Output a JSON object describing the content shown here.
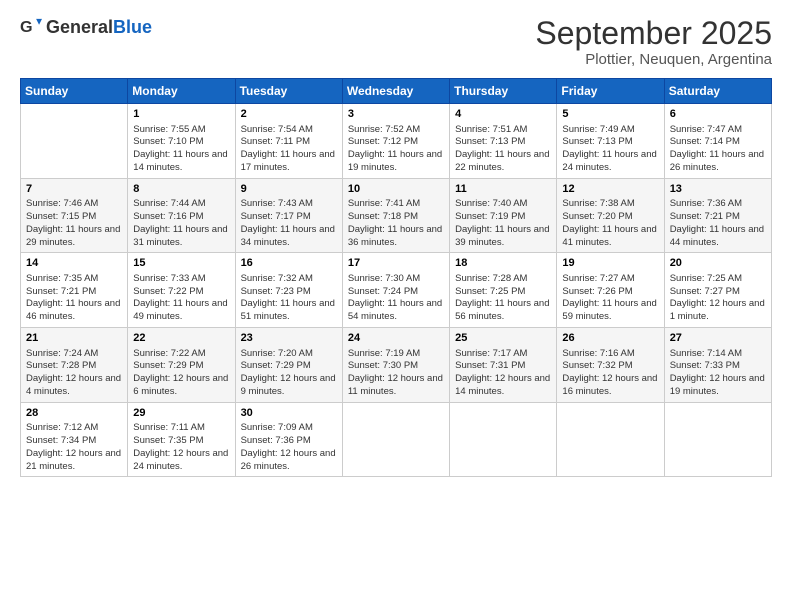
{
  "logo": {
    "general": "General",
    "blue": "Blue"
  },
  "title": "September 2025",
  "subtitle": "Plottier, Neuquen, Argentina",
  "days": [
    "Sunday",
    "Monday",
    "Tuesday",
    "Wednesday",
    "Thursday",
    "Friday",
    "Saturday"
  ],
  "weeks": [
    [
      {
        "date": "",
        "sunrise": "",
        "sunset": "",
        "daylight": ""
      },
      {
        "date": "1",
        "sunrise": "Sunrise: 7:55 AM",
        "sunset": "Sunset: 7:10 PM",
        "daylight": "Daylight: 11 hours and 14 minutes."
      },
      {
        "date": "2",
        "sunrise": "Sunrise: 7:54 AM",
        "sunset": "Sunset: 7:11 PM",
        "daylight": "Daylight: 11 hours and 17 minutes."
      },
      {
        "date": "3",
        "sunrise": "Sunrise: 7:52 AM",
        "sunset": "Sunset: 7:12 PM",
        "daylight": "Daylight: 11 hours and 19 minutes."
      },
      {
        "date": "4",
        "sunrise": "Sunrise: 7:51 AM",
        "sunset": "Sunset: 7:13 PM",
        "daylight": "Daylight: 11 hours and 22 minutes."
      },
      {
        "date": "5",
        "sunrise": "Sunrise: 7:49 AM",
        "sunset": "Sunset: 7:13 PM",
        "daylight": "Daylight: 11 hours and 24 minutes."
      },
      {
        "date": "6",
        "sunrise": "Sunrise: 7:47 AM",
        "sunset": "Sunset: 7:14 PM",
        "daylight": "Daylight: 11 hours and 26 minutes."
      }
    ],
    [
      {
        "date": "7",
        "sunrise": "Sunrise: 7:46 AM",
        "sunset": "Sunset: 7:15 PM",
        "daylight": "Daylight: 11 hours and 29 minutes."
      },
      {
        "date": "8",
        "sunrise": "Sunrise: 7:44 AM",
        "sunset": "Sunset: 7:16 PM",
        "daylight": "Daylight: 11 hours and 31 minutes."
      },
      {
        "date": "9",
        "sunrise": "Sunrise: 7:43 AM",
        "sunset": "Sunset: 7:17 PM",
        "daylight": "Daylight: 11 hours and 34 minutes."
      },
      {
        "date": "10",
        "sunrise": "Sunrise: 7:41 AM",
        "sunset": "Sunset: 7:18 PM",
        "daylight": "Daylight: 11 hours and 36 minutes."
      },
      {
        "date": "11",
        "sunrise": "Sunrise: 7:40 AM",
        "sunset": "Sunset: 7:19 PM",
        "daylight": "Daylight: 11 hours and 39 minutes."
      },
      {
        "date": "12",
        "sunrise": "Sunrise: 7:38 AM",
        "sunset": "Sunset: 7:20 PM",
        "daylight": "Daylight: 11 hours and 41 minutes."
      },
      {
        "date": "13",
        "sunrise": "Sunrise: 7:36 AM",
        "sunset": "Sunset: 7:21 PM",
        "daylight": "Daylight: 11 hours and 44 minutes."
      }
    ],
    [
      {
        "date": "14",
        "sunrise": "Sunrise: 7:35 AM",
        "sunset": "Sunset: 7:21 PM",
        "daylight": "Daylight: 11 hours and 46 minutes."
      },
      {
        "date": "15",
        "sunrise": "Sunrise: 7:33 AM",
        "sunset": "Sunset: 7:22 PM",
        "daylight": "Daylight: 11 hours and 49 minutes."
      },
      {
        "date": "16",
        "sunrise": "Sunrise: 7:32 AM",
        "sunset": "Sunset: 7:23 PM",
        "daylight": "Daylight: 11 hours and 51 minutes."
      },
      {
        "date": "17",
        "sunrise": "Sunrise: 7:30 AM",
        "sunset": "Sunset: 7:24 PM",
        "daylight": "Daylight: 11 hours and 54 minutes."
      },
      {
        "date": "18",
        "sunrise": "Sunrise: 7:28 AM",
        "sunset": "Sunset: 7:25 PM",
        "daylight": "Daylight: 11 hours and 56 minutes."
      },
      {
        "date": "19",
        "sunrise": "Sunrise: 7:27 AM",
        "sunset": "Sunset: 7:26 PM",
        "daylight": "Daylight: 11 hours and 59 minutes."
      },
      {
        "date": "20",
        "sunrise": "Sunrise: 7:25 AM",
        "sunset": "Sunset: 7:27 PM",
        "daylight": "Daylight: 12 hours and 1 minute."
      }
    ],
    [
      {
        "date": "21",
        "sunrise": "Sunrise: 7:24 AM",
        "sunset": "Sunset: 7:28 PM",
        "daylight": "Daylight: 12 hours and 4 minutes."
      },
      {
        "date": "22",
        "sunrise": "Sunrise: 7:22 AM",
        "sunset": "Sunset: 7:29 PM",
        "daylight": "Daylight: 12 hours and 6 minutes."
      },
      {
        "date": "23",
        "sunrise": "Sunrise: 7:20 AM",
        "sunset": "Sunset: 7:29 PM",
        "daylight": "Daylight: 12 hours and 9 minutes."
      },
      {
        "date": "24",
        "sunrise": "Sunrise: 7:19 AM",
        "sunset": "Sunset: 7:30 PM",
        "daylight": "Daylight: 12 hours and 11 minutes."
      },
      {
        "date": "25",
        "sunrise": "Sunrise: 7:17 AM",
        "sunset": "Sunset: 7:31 PM",
        "daylight": "Daylight: 12 hours and 14 minutes."
      },
      {
        "date": "26",
        "sunrise": "Sunrise: 7:16 AM",
        "sunset": "Sunset: 7:32 PM",
        "daylight": "Daylight: 12 hours and 16 minutes."
      },
      {
        "date": "27",
        "sunrise": "Sunrise: 7:14 AM",
        "sunset": "Sunset: 7:33 PM",
        "daylight": "Daylight: 12 hours and 19 minutes."
      }
    ],
    [
      {
        "date": "28",
        "sunrise": "Sunrise: 7:12 AM",
        "sunset": "Sunset: 7:34 PM",
        "daylight": "Daylight: 12 hours and 21 minutes."
      },
      {
        "date": "29",
        "sunrise": "Sunrise: 7:11 AM",
        "sunset": "Sunset: 7:35 PM",
        "daylight": "Daylight: 12 hours and 24 minutes."
      },
      {
        "date": "30",
        "sunrise": "Sunrise: 7:09 AM",
        "sunset": "Sunset: 7:36 PM",
        "daylight": "Daylight: 12 hours and 26 minutes."
      },
      {
        "date": "",
        "sunrise": "",
        "sunset": "",
        "daylight": ""
      },
      {
        "date": "",
        "sunrise": "",
        "sunset": "",
        "daylight": ""
      },
      {
        "date": "",
        "sunrise": "",
        "sunset": "",
        "daylight": ""
      },
      {
        "date": "",
        "sunrise": "",
        "sunset": "",
        "daylight": ""
      }
    ]
  ]
}
